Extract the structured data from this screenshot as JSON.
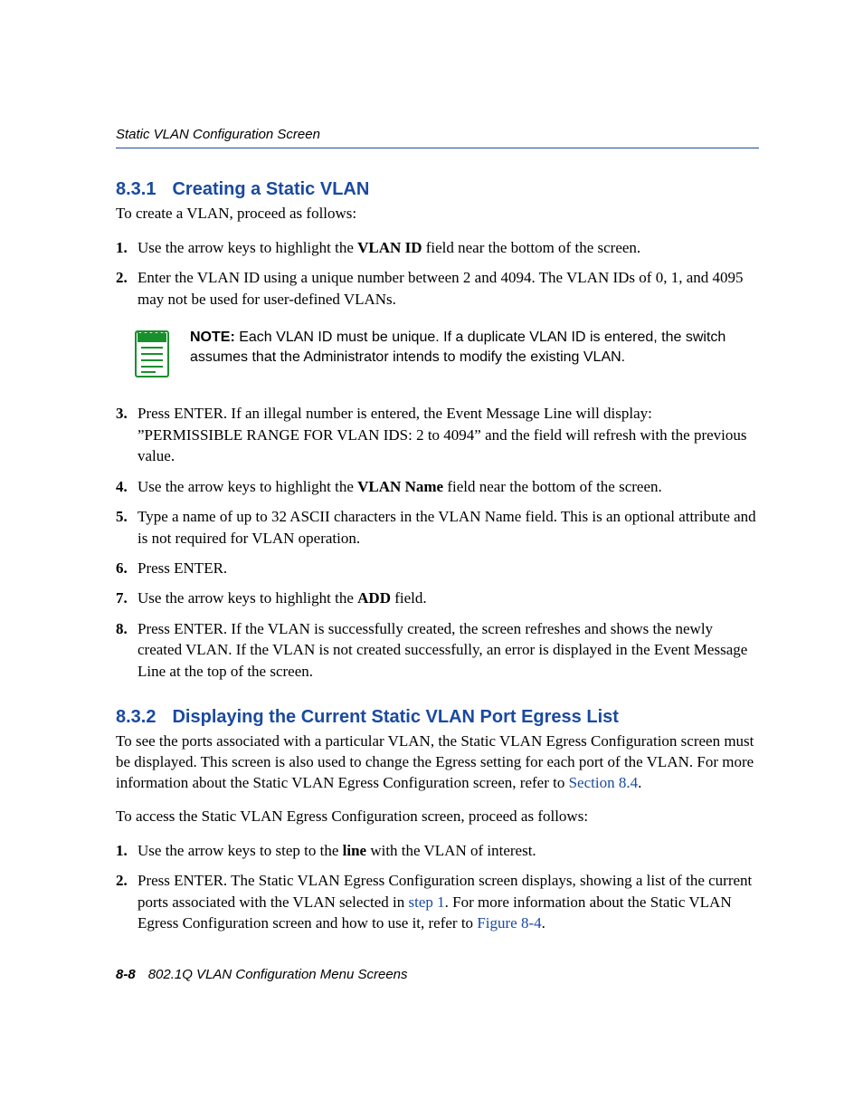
{
  "header": {
    "title": "Static VLAN Configuration Screen"
  },
  "section1": {
    "num": "8.3.1",
    "title": "Creating a Static VLAN",
    "intro": "To create a VLAN, proceed as follows:",
    "steps": {
      "s1a": "Use the arrow keys to highlight the ",
      "s1b": "VLAN ID",
      "s1c": " field near the bottom of the screen.",
      "s2": "Enter the VLAN ID using a unique number between 2 and 4094. The VLAN IDs of 0, 1, and 4095 may not be used for user-defined VLANs.",
      "s3": "Press ENTER. If an illegal number is entered, the Event Message Line will display: ”PERMISSIBLE RANGE FOR VLAN IDS: 2 to 4094” and the field will refresh with the previous value.",
      "s4a": "Use the arrow keys to highlight the ",
      "s4b": "VLAN Name",
      "s4c": " field near the bottom of the screen.",
      "s5": "Type a name of up to 32 ASCII characters in the VLAN Name field. This is an optional attribute and is not required for VLAN operation.",
      "s6": "Press ENTER.",
      "s7a": "Use the arrow keys to highlight the ",
      "s7b": "ADD",
      "s7c": " field.",
      "s8": "Press ENTER. If the VLAN is successfully created, the screen refreshes and shows the newly created VLAN. If the VLAN is not created successfully, an error is displayed in the Event Message Line at the top of the screen."
    },
    "note": {
      "label": "NOTE:",
      "text": " Each VLAN ID must be unique. If a duplicate VLAN ID is entered, the switch assumes that the Administrator intends to modify the existing VLAN."
    }
  },
  "section2": {
    "num": "8.3.2",
    "title": "Displaying the Current Static VLAN Port Egress List",
    "intro1a": "To see the ports associated with a particular VLAN, the Static VLAN Egress Configuration screen must be displayed. This screen is also used to change the Egress setting for each port of the VLAN. For more information about the Static VLAN Egress Configuration screen, refer to ",
    "intro1_link": "Section 8.4",
    "intro1b": ".",
    "intro2": "To access the Static VLAN Egress Configuration screen, proceed as follows:",
    "steps": {
      "s1a": "Use the arrow keys to step to the ",
      "s1b": "line",
      "s1c": " with the VLAN of interest.",
      "s2a": "Press ENTER. The Static VLAN Egress Configuration screen displays, showing a list of the current ports associated with the VLAN selected in ",
      "s2_link1": "step 1",
      "s2b": ". For more information about the Static VLAN Egress Configuration screen and how to use it, refer to ",
      "s2_link2": "Figure 8-4",
      "s2c": "."
    }
  },
  "footer": {
    "page_num": "8-8",
    "chapter": "802.1Q VLAN Configuration Menu Screens"
  }
}
